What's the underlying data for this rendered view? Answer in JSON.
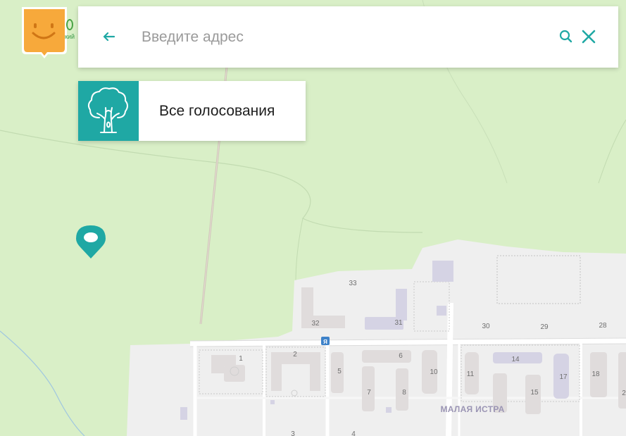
{
  "search": {
    "placeholder": "Введите адрес",
    "value": ""
  },
  "votes_button": {
    "label": "Все голосования"
  },
  "logo_side_text": "кий",
  "map": {
    "district_label": "МАЛАЯ ИСТРА",
    "bus_stop_symbol": "Я",
    "house_numbers": [
      "33",
      "32",
      "31",
      "30",
      "29",
      "28",
      "1",
      "2",
      "5",
      "6",
      "7",
      "8",
      "10",
      "11",
      "14",
      "17",
      "15",
      "18",
      "2",
      "3",
      "4"
    ]
  },
  "colors": {
    "accent": "#1fa8a4",
    "forest": "#d9efc7",
    "urban": "#f0f0f0",
    "logo": "#f7a93b"
  },
  "icons": {
    "back": "arrow-left-icon",
    "search": "search-icon",
    "clear": "close-icon",
    "votes": "tree-icon",
    "pin": "map-pin-icon",
    "logo": "smiley-shield-logo"
  }
}
